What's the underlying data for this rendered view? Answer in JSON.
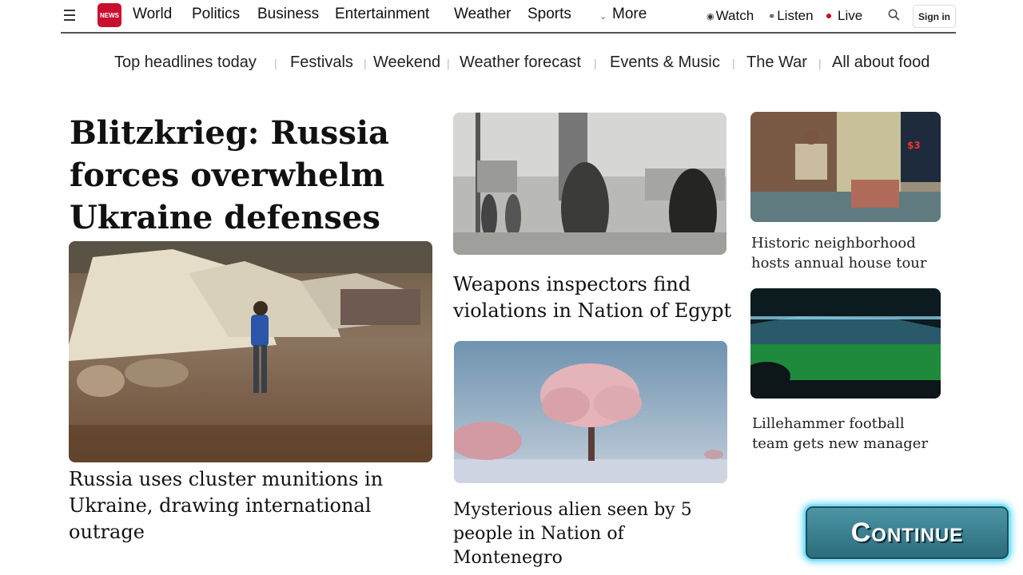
{
  "header": {
    "logo_text": "NEWS",
    "nav": [
      "World",
      "Politics",
      "Business",
      "Entertainment",
      "Weather",
      "Sports"
    ],
    "more_label": "More",
    "watch_label": "Watch",
    "listen_label": "Listen",
    "live_label": "Live",
    "signin_label": "Sign in"
  },
  "subnav": [
    "Top headlines today",
    "Festivals",
    "Weekend",
    "Weather forecast",
    "Events & Music",
    "The War",
    "All about food"
  ],
  "lead": {
    "title": "Blitzkrieg: Russia forces overwhelm Ukraine defenses",
    "caption": "Russia uses cluster munitions in Ukraine, drawing international outrage"
  },
  "middle": [
    {
      "caption": "Weapons inspectors find violations in Nation of Egypt"
    },
    {
      "caption": "Mysterious alien seen by 5 people in Nation of Montenegro"
    }
  ],
  "right": [
    {
      "caption": "Historic neighborhood hosts annual house tour"
    },
    {
      "caption": "Lillehammer football team gets new manager"
    }
  ],
  "continue_label": "Continue",
  "colors": {
    "brand": "#c8102e",
    "live": "#d0021b",
    "continue_bg": "#3e8898",
    "continue_glow": "#7fe3ff"
  }
}
